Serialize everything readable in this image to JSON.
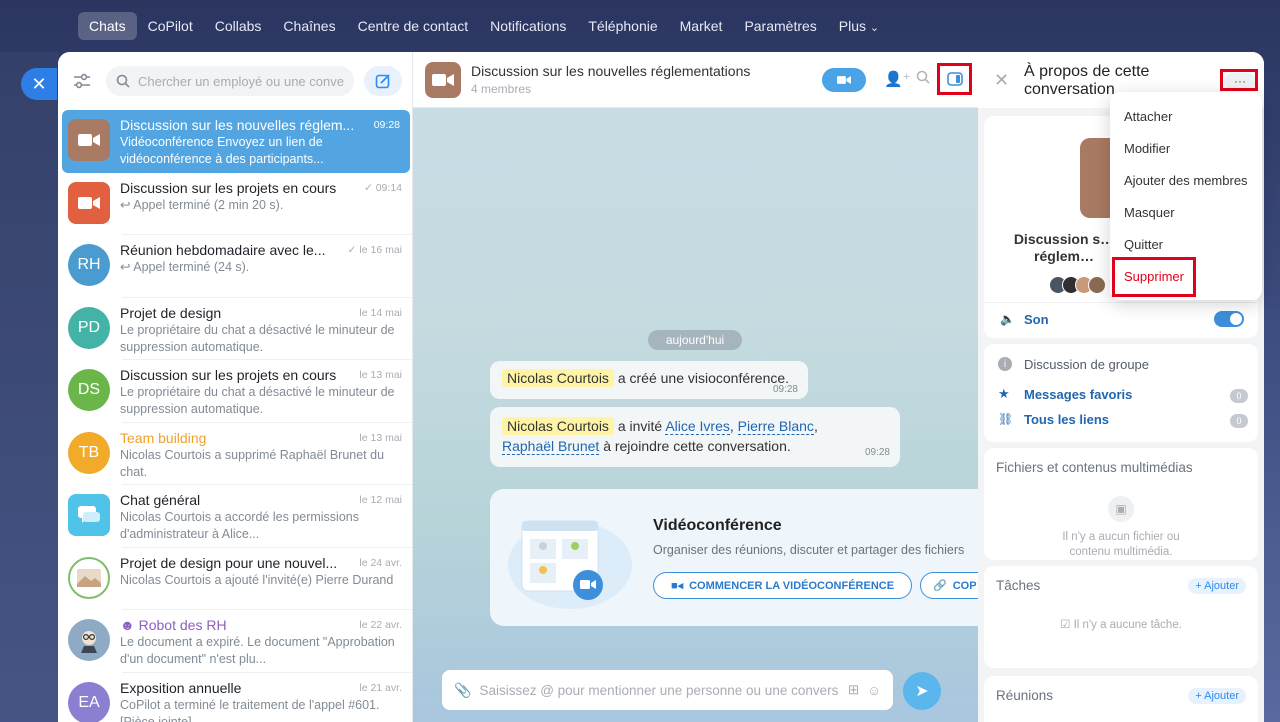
{
  "topnav": {
    "items": [
      "Chats",
      "CoPilot",
      "Collabs",
      "Chaînes",
      "Centre de contact",
      "Notifications",
      "Téléphonie",
      "Market",
      "Paramètres",
      "Plus"
    ],
    "plus_arrow": "⌄"
  },
  "list": {
    "search_placeholder": "Chercher un employé ou une conve",
    "items": [
      {
        "title": "Discussion sur les nouvelles réglem...",
        "date": "09:28",
        "sub": "Vidéoconférence Envoyez un lien de vidéoconférence à des participants...",
        "avatar_color": "#a97a63",
        "icon": "video-icon"
      },
      {
        "title": "Discussion sur les projets en cours",
        "date": "09:14",
        "sub": "↩ Appel terminé (2 min 20 s).",
        "avatar_color": "#e0603f",
        "icon": "video-icon",
        "check": "✓"
      },
      {
        "title": "Réunion hebdomadaire avec le...",
        "date": "le 16 mai",
        "sub": "↩ Appel terminé (24 s).",
        "avatar_color": "#4a9bd0",
        "initials": "RH",
        "check": "✓"
      },
      {
        "title": "Projet de design",
        "date": "le 14 mai",
        "sub": "Le propriétaire du chat a désactivé le minuteur de suppression automatique.",
        "avatar_color": "#43b3a8",
        "initials": "PD"
      },
      {
        "title": "Discussion sur les projets en cours",
        "date": "le 13 mai",
        "sub": "Le propriétaire du chat a désactivé le minuteur de suppression automatique.",
        "avatar_color": "#6bb64a",
        "initials": "DS"
      },
      {
        "title": "Team building",
        "date": "le 13 mai",
        "sub": "Nicolas Courtois a supprimé Raphaël Brunet du chat.",
        "avatar_color": "#f2aa2a",
        "initials": "TB"
      },
      {
        "title": "Chat général",
        "date": "le 12 mai",
        "sub": "Nicolas Courtois a accordé les permissions d'administrateur à Alice...",
        "avatar_color": "#4fc3e8",
        "icon": "chat-icon"
      },
      {
        "title": "Projet de design pour une nouvel...",
        "date": "le 24 avr.",
        "sub": "Nicolas Courtois a ajouté l'invité(e) Pierre Durand",
        "avatar_color": "#7fbf6a",
        "icon": "image-icon"
      },
      {
        "title": "Robot des RH",
        "date": "le 22 avr.",
        "sub": "Le document a expiré. Le document \"Approbation d'un document\" n'est plu...",
        "avatar_color": "#8faac4",
        "icon": "robot-icon",
        "prefix": "☻"
      },
      {
        "title": "Exposition annuelle",
        "date": "le 21 avr.",
        "sub": "CoPilot a terminé le traitement de l'appel #601. [Pièce jointe]",
        "avatar_color": "#8a7fd0",
        "initials": "EA"
      }
    ]
  },
  "chat": {
    "title": "Discussion sur les nouvelles réglementations",
    "members": "4 membres",
    "day": "aujourd'hui",
    "msg1": {
      "name": "Nicolas Courtois",
      "text": "a créé une visioconférence.",
      "time": "09:28"
    },
    "msg2": {
      "name": "Nicolas Courtois",
      "text1": "a invité",
      "l1": "Alice Ivres",
      "c1": ",",
      "l2": "Pierre Blanc",
      "c2": ",",
      "l3": "Raphaël Brunet",
      "text2": "à rejoindre cette conversation.",
      "time": "09:28"
    },
    "vc": {
      "title": "Vidéoconférence",
      "desc": "Organiser des réunions, discuter et partager des fichiers",
      "start": "COMMENCER LA VIDÉOCONFÉRENCE",
      "copy": "COP"
    },
    "input_placeholder": "Saisissez @ pour mentionner une personne ou une convers"
  },
  "right": {
    "title": "À propos de cette conversation",
    "dots": "···",
    "chatname": "Discussion s… réglem…",
    "sound": "Son",
    "group": "Discussion de groupe",
    "fav": "Messages favoris",
    "fav_count": "0",
    "links": "Tous les liens",
    "links_count": "0",
    "files_title": "Fichiers et contenus multimédias",
    "files_empty": "Il n'y a aucun fichier ou contenu multimédia.",
    "tasks_title": "Tâches",
    "tasks_add": "+ Ajouter",
    "tasks_empty": "Il n'y a aucune tâche.",
    "meet_title": "Réunions",
    "meet_add": "+ Ajouter"
  },
  "menu": {
    "items": [
      "Attacher",
      "Modifier",
      "Ajouter des membres",
      "Masquer",
      "Quitter"
    ],
    "delete": "Supprimer"
  },
  "colors": {
    "accent": "#2d7ee5",
    "highlight_border": "#e3001b",
    "selected": "#52a5e0"
  }
}
